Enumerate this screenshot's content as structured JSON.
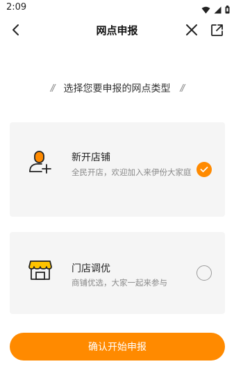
{
  "status_bar": {
    "time": "2:09",
    "icons": [
      "wifi-icon",
      "signal-icon",
      "battery-icon"
    ]
  },
  "nav": {
    "title": "网点申报",
    "back_icon": "back-arrow-icon",
    "close_icon": "close-icon",
    "share_icon": "share-external-icon"
  },
  "prompt": {
    "left_deco": "//",
    "text": "选择您要申报的网点类型",
    "right_deco": "//"
  },
  "options": [
    {
      "icon": "add-user-icon",
      "title": "新开店铺",
      "description": "全民开店，欢迎加入来伊份大家庭",
      "selected": true
    },
    {
      "icon": "storefront-icon",
      "title": "门店调优",
      "description": "商铺优选，大家一起来参与",
      "selected": false
    }
  ],
  "submit_button": {
    "label": "确认开始申报"
  },
  "colors": {
    "accent": "#ff8a00",
    "card_bg": "#f5f5f5",
    "text_primary": "#222222",
    "text_secondary": "#8a8a8a"
  }
}
